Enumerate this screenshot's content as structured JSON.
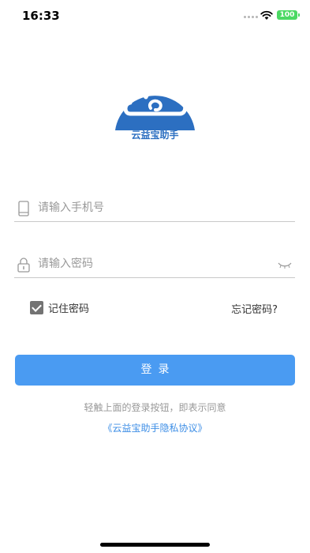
{
  "status_bar": {
    "time": "16:33",
    "battery": "100",
    "icons": [
      "signal-dots-icon",
      "wifi-icon",
      "battery-icon"
    ]
  },
  "logo": {
    "text": "云益宝助手",
    "icon": "cloud-logo-icon",
    "brand_color": "#2c6fc1"
  },
  "form": {
    "phone_placeholder": "请输入手机号",
    "phone_icon": "phone-icon",
    "password_placeholder": "请输入密码",
    "password_icon": "lock-icon",
    "eye_icon": "eye-closed-icon",
    "remember_label": "记住密码",
    "remember_checked": true,
    "forgot_label": "忘记密码?"
  },
  "login_button": {
    "label": "登录",
    "color": "#4a9bf2"
  },
  "agreement": {
    "hint": "轻触上面的登录按钮，即表示同意",
    "link": "《云益宝助手隐私协议》",
    "link_color": "#3d8ee6"
  }
}
